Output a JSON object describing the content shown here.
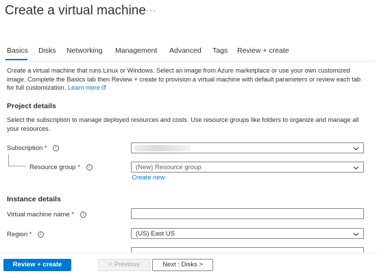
{
  "page": {
    "title": "Create a virtual machine",
    "more": "···"
  },
  "tabs": [
    {
      "label": "Basics",
      "active": true
    },
    {
      "label": "Disks"
    },
    {
      "label": "Networking"
    },
    {
      "label": "Management"
    },
    {
      "label": "Advanced"
    },
    {
      "label": "Tags"
    },
    {
      "label": "Review + create"
    }
  ],
  "intro": {
    "text": "Create a virtual machine that runs Linux or Windows. Select an image from Azure marketplace or use your own customized image. Complete the Basics tab then Review + create to provision a virtual machine with default parameters or review each tab for full customization.",
    "learn_more": "Learn more"
  },
  "project_details": {
    "heading": "Project details",
    "description": "Select the subscription to manage deployed resources and costs. Use resource groups like folders to organize and manage all your resources.",
    "subscription_label": "Subscription",
    "required_mark": "*",
    "resource_group_label": "Resource group",
    "resource_group_value": "(New) Resource group",
    "create_new": "Create new"
  },
  "instance_details": {
    "heading": "Instance details",
    "vm_name_label": "Virtual machine name",
    "vm_name_value": "",
    "region_label": "Region",
    "region_value": "(US) East US"
  },
  "footer": {
    "review_create": "Review + create",
    "previous": "< Previous",
    "next": "Next : Disks >"
  },
  "colors": {
    "accent": "#0078d4",
    "required": "#a4262c",
    "text": "#323130"
  }
}
